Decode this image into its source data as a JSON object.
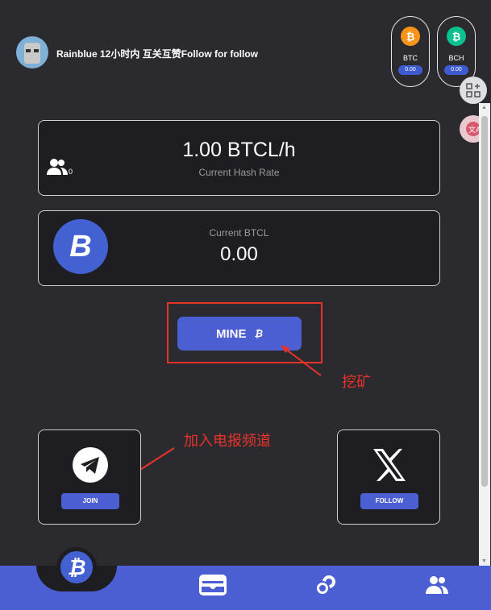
{
  "header": {
    "username": "Rainblue 12小时内 互关互赞Follow for follow"
  },
  "coins": [
    {
      "label": "BTC",
      "value": "0.00",
      "color": "#f7931a",
      "symbol": "₿"
    },
    {
      "label": "BCH",
      "value": "0.00",
      "color": "#0ac18e",
      "symbol": "₿"
    }
  ],
  "side_icons": [
    "apps-plus-icon",
    "translate-icon"
  ],
  "hash_card": {
    "value": "1.00 BTCL/h",
    "label": "Current Hash Rate",
    "referrals": "0"
  },
  "btcl_card": {
    "label": "Current BTCL",
    "value": "0.00"
  },
  "mine_button": {
    "label": "MINE",
    "symbol": "₿"
  },
  "annotations": {
    "mine": "挖矿",
    "telegram": "加入电报频道"
  },
  "social": {
    "telegram_button": "JOIN",
    "x_button": "FOLLOW"
  },
  "bottom_nav": {
    "home_symbol": "₿",
    "icons": [
      "btc-home-icon",
      "wallet-icon",
      "coins-icon",
      "friends-icon"
    ]
  },
  "colors": {
    "accent": "#4b5fd3",
    "annotation": "#e8332b",
    "card_bg": "#1d1d22",
    "page_bg": "#2b2b2f"
  }
}
